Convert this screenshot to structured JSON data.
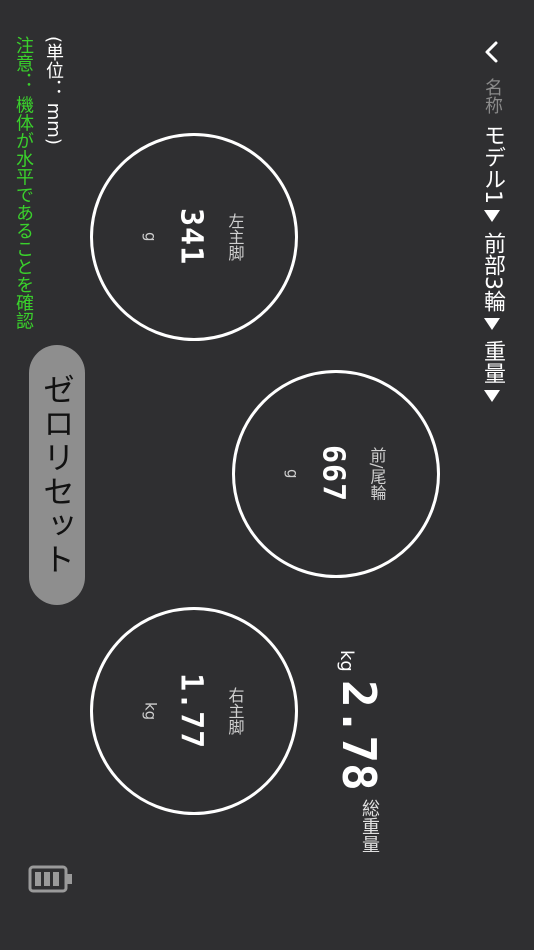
{
  "header": {
    "back_icon": "chevron-left-icon",
    "name_label": "名称",
    "model": "モデル1",
    "config": "前部3輪",
    "mode": "重量"
  },
  "notes": {
    "unit": "(単位： mm)",
    "warning": "注意： 機体が水平であることを確認"
  },
  "gauges": {
    "left": {
      "label": "左主脚",
      "value": "341",
      "unit": "g"
    },
    "front": {
      "label": "前/尾輪",
      "value": "667",
      "unit": "g"
    },
    "right": {
      "label": "右主脚",
      "value": "1.77",
      "unit": "kg"
    }
  },
  "total": {
    "label": "総重量",
    "value": "2.78",
    "unit": "kg"
  },
  "zero_button": {
    "label": "ゼロリセット"
  },
  "battery": {
    "icon": "battery-icon"
  },
  "colors": {
    "background": "#2f2f31",
    "accent_green": "#3ad12c",
    "button_gray": "#8e8e8e"
  }
}
